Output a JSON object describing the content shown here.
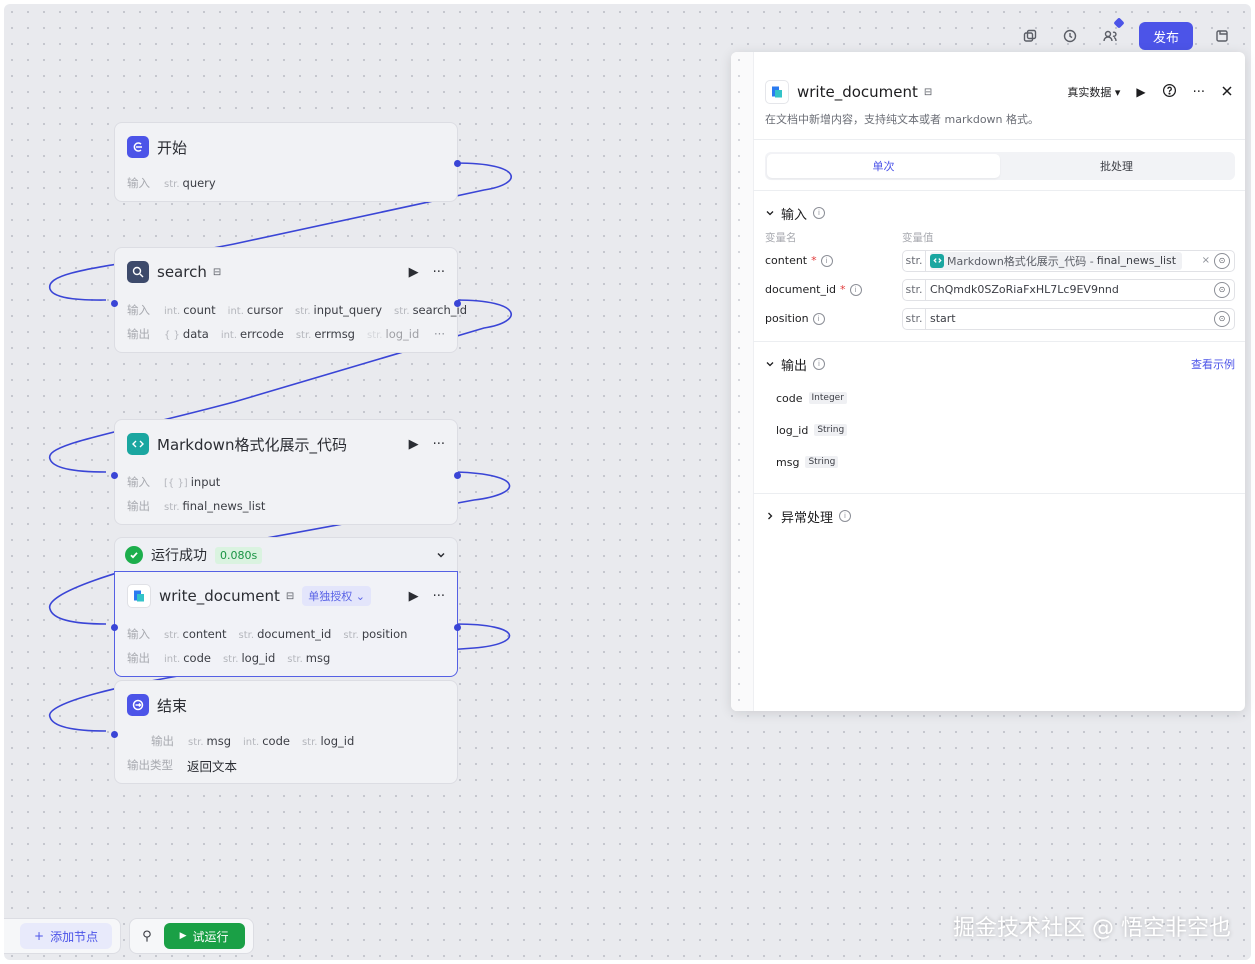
{
  "toolbar": {
    "publish_label": "发布"
  },
  "nodes": {
    "start": {
      "title": "开始",
      "input_label": "输入",
      "inputs": [
        {
          "type": "str.",
          "name": "query"
        }
      ]
    },
    "search": {
      "title": "search",
      "input_label": "输入",
      "output_label": "输出",
      "inputs": [
        {
          "type": "int.",
          "name": "count"
        },
        {
          "type": "int.",
          "name": "cursor"
        },
        {
          "type": "str.",
          "name": "input_query"
        },
        {
          "type": "str.",
          "name": "search_id"
        }
      ],
      "outputs": [
        {
          "type": "{ }",
          "name": "data"
        },
        {
          "type": "int.",
          "name": "errcode"
        },
        {
          "type": "str.",
          "name": "errmsg"
        },
        {
          "type": "str.",
          "name": "log_id"
        }
      ],
      "more": "···"
    },
    "markdown": {
      "title": "Markdown格式化展示_代码",
      "input_label": "输入",
      "output_label": "输出",
      "inputs": [
        {
          "type": "[{ }]",
          "name": "input"
        }
      ],
      "outputs": [
        {
          "type": "str.",
          "name": "final_news_list"
        }
      ]
    },
    "run_result": {
      "status": "运行成功",
      "time": "0.080s"
    },
    "write_document": {
      "title": "write_document",
      "auth": "单独授权",
      "input_label": "输入",
      "output_label": "输出",
      "inputs": [
        {
          "type": "str.",
          "name": "content"
        },
        {
          "type": "str.",
          "name": "document_id"
        },
        {
          "type": "str.",
          "name": "position"
        }
      ],
      "outputs": [
        {
          "type": "int.",
          "name": "code"
        },
        {
          "type": "str.",
          "name": "log_id"
        },
        {
          "type": "str.",
          "name": "msg"
        }
      ]
    },
    "end": {
      "title": "结束",
      "output_label": "输出",
      "outputs": [
        {
          "type": "str.",
          "name": "msg"
        },
        {
          "type": "int.",
          "name": "code"
        },
        {
          "type": "str.",
          "name": "log_id"
        }
      ],
      "output_type_label": "输出类型",
      "output_type_value": "返回文本"
    }
  },
  "bottom": {
    "add_node": "添加节点",
    "trial_run": "试运行"
  },
  "watermark": "掘金技术社区 @ 悟空非空也",
  "panel": {
    "title": "write_document",
    "data_mode": "真实数据",
    "description": "在文档中新增内容，支持纯文本或者 markdown 格式。",
    "tabs": [
      "单次",
      "批处理"
    ],
    "input_section": "输入",
    "col_name": "变量名",
    "col_value": "变量值",
    "inputs": [
      {
        "name": "content",
        "required": true,
        "type": "str.",
        "ref_node": "Markdown格式化展示_代码 - ",
        "ref_var": "final_news_list",
        "clear": "×"
      },
      {
        "name": "document_id",
        "required": true,
        "type": "str.",
        "value": "ChQmdk0SZoRiaFxHL7Lc9EV9nnd"
      },
      {
        "name": "position",
        "required": false,
        "type": "str.",
        "value": "start"
      }
    ],
    "output_section": "输出",
    "view_example": "查看示例",
    "outputs": [
      {
        "name": "code",
        "type": "Integer"
      },
      {
        "name": "log_id",
        "type": "String"
      },
      {
        "name": "msg",
        "type": "String"
      }
    ],
    "error_section": "异常处理"
  }
}
